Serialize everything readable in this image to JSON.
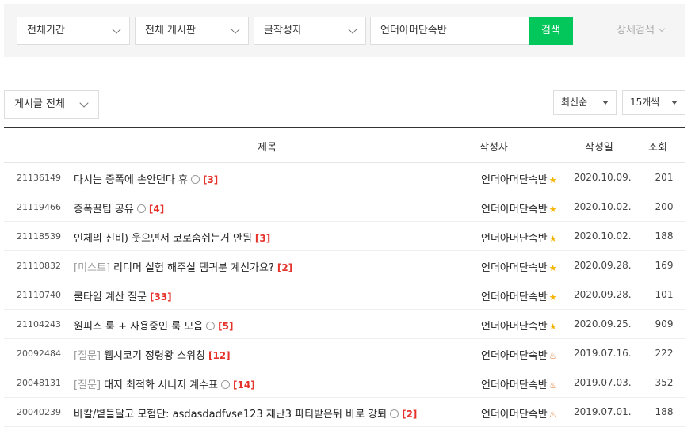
{
  "search": {
    "period": "전체기간",
    "board": "전체 게시판",
    "type": "글작성자",
    "query": "언더아머단속반",
    "button": "검색",
    "detail": "상세검색"
  },
  "filter": {
    "all_posts": "게시글 전체",
    "sort": "최신순",
    "per_page": "15개씩"
  },
  "table": {
    "headers": {
      "title": "제목",
      "author": "작성자",
      "date": "작성일",
      "views": "조회"
    },
    "rows": [
      {
        "num": "21136149",
        "prefix": "",
        "title": "다시는 증폭에 손안댄다 휴",
        "image": true,
        "comments": "[3]",
        "author": "언더아머단속반",
        "level": "★",
        "level_type": "star",
        "date": "2020.10.09.",
        "views": "201"
      },
      {
        "num": "21119466",
        "prefix": "",
        "title": "증폭꿀팁 공유",
        "image": true,
        "comments": "[4]",
        "author": "언더아머단속반",
        "level": "★",
        "level_type": "star",
        "date": "2020.10.02.",
        "views": "200"
      },
      {
        "num": "21118539",
        "prefix": "",
        "title": "인체의 신비) 웃으면서 코로숨쉬는거 안됨",
        "image": false,
        "comments": "[3]",
        "author": "언더아머단속반",
        "level": "★",
        "level_type": "star",
        "date": "2020.10.02.",
        "views": "188"
      },
      {
        "num": "21110832",
        "prefix": "[미스트]",
        "title": "리디머 실험 해주실 템귀분 계신가요?",
        "image": false,
        "comments": "[2]",
        "author": "언더아머단속반",
        "level": "★",
        "level_type": "star",
        "date": "2020.09.28.",
        "views": "169"
      },
      {
        "num": "21110740",
        "prefix": "",
        "title": "쿨타임 계산 질문",
        "image": false,
        "comments": "[33]",
        "author": "언더아머단속반",
        "level": "★",
        "level_type": "star",
        "date": "2020.09.28.",
        "views": "101"
      },
      {
        "num": "21104243",
        "prefix": "",
        "title": "원피스 룩 + 사용중인 룩 모음",
        "image": true,
        "comments": "[5]",
        "author": "언더아머단속반",
        "level": "★",
        "level_type": "star",
        "date": "2020.09.25.",
        "views": "909"
      },
      {
        "num": "20092484",
        "prefix": "[질문]",
        "title": "웹시코기 정령왕 스위칭",
        "image": false,
        "comments": "[12]",
        "author": "언더아머단속반",
        "level": "♨",
        "level_type": "sprout",
        "date": "2019.07.16.",
        "views": "222"
      },
      {
        "num": "20048131",
        "prefix": "[질문]",
        "title": "대지 최적화 시너지 계수표",
        "image": true,
        "comments": "[14]",
        "author": "언더아머단속반",
        "level": "♨",
        "level_type": "sprout",
        "date": "2019.07.03.",
        "views": "352"
      },
      {
        "num": "20040239",
        "prefix": "",
        "title": "바칼/볕들달고 모험단: asdasdadfvse123 재난3 파티받은뒤 바로 강퇴",
        "image": true,
        "comments": "[2]",
        "author": "언더아머단속반",
        "level": "♨",
        "level_type": "sprout",
        "date": "2019.07.01.",
        "views": "188"
      }
    ]
  }
}
